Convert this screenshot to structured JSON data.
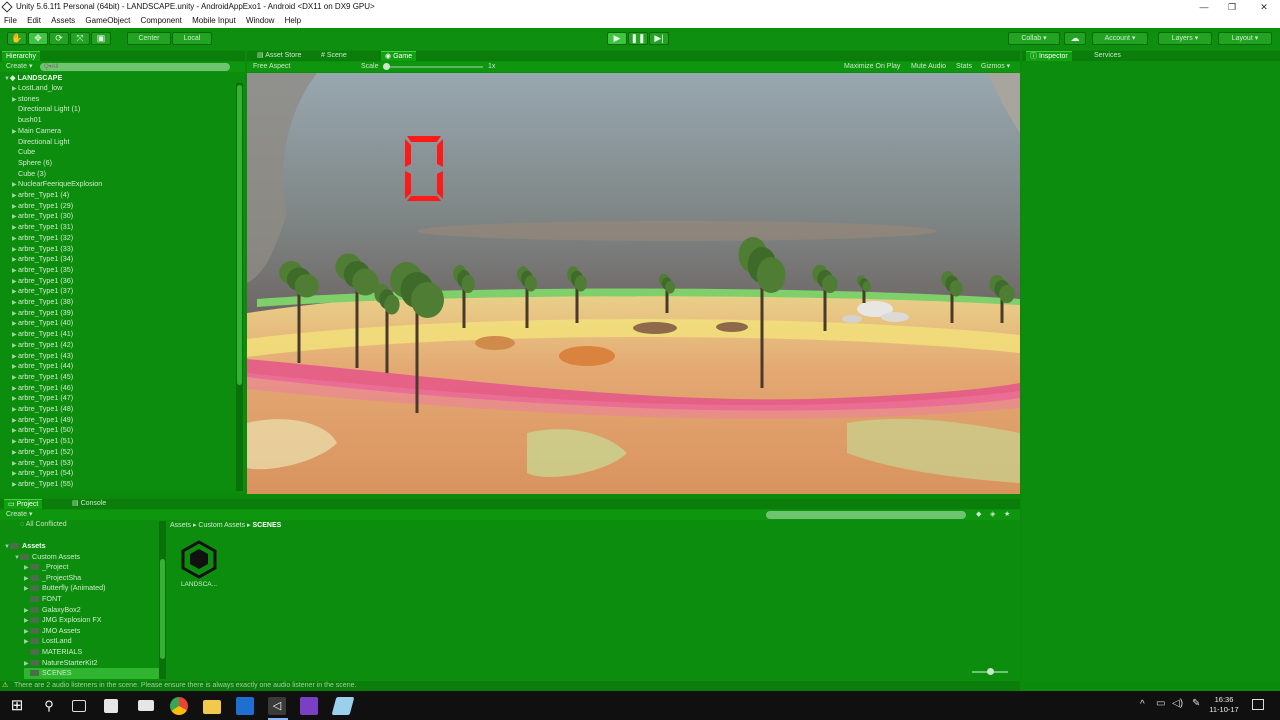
{
  "window": {
    "title": "Unity 5.6.1f1 Personal (64bit) - LANDSCAPE.unity - AndroidAppExo1 - Android <DX11 on DX9 GPU>",
    "controls": [
      "—",
      "❐",
      "✕"
    ]
  },
  "menu": [
    "File",
    "Edit",
    "Assets",
    "GameObject",
    "Component",
    "Mobile Input",
    "Window",
    "Help"
  ],
  "toolbar": {
    "pivot_mode": "Center",
    "pivot_space": "Local",
    "collab": "Collab ▾",
    "account": "Account",
    "layers": "Layers",
    "layout": "Layout"
  },
  "hierarchy": {
    "tab": "Hierarchy",
    "create": "Create ▾",
    "search_placeholder": "Q▾All",
    "scene": "LANDSCAPE",
    "items": [
      {
        "label": "LostLand_low",
        "arrow": "▶"
      },
      {
        "label": "stones",
        "arrow": "▶"
      },
      {
        "label": "Directional Light (1)",
        "arrow": ""
      },
      {
        "label": "bush01",
        "arrow": ""
      },
      {
        "label": "Main Camera",
        "arrow": "▶"
      },
      {
        "label": "Directional Light",
        "arrow": ""
      },
      {
        "label": "Cube",
        "arrow": ""
      },
      {
        "label": "Sphere (6)",
        "arrow": ""
      },
      {
        "label": "Cube (3)",
        "arrow": ""
      },
      {
        "label": "NuclearFeeriqueExplosion",
        "arrow": "▶"
      },
      {
        "label": "arbre_Type1 (4)",
        "arrow": "▶"
      },
      {
        "label": "arbre_Type1 (29)",
        "arrow": "▶"
      },
      {
        "label": "arbre_Type1 (30)",
        "arrow": "▶"
      },
      {
        "label": "arbre_Type1 (31)",
        "arrow": "▶"
      },
      {
        "label": "arbre_Type1 (32)",
        "arrow": "▶"
      },
      {
        "label": "arbre_Type1 (33)",
        "arrow": "▶"
      },
      {
        "label": "arbre_Type1 (34)",
        "arrow": "▶"
      },
      {
        "label": "arbre_Type1 (35)",
        "arrow": "▶"
      },
      {
        "label": "arbre_Type1 (36)",
        "arrow": "▶"
      },
      {
        "label": "arbre_Type1 (37)",
        "arrow": "▶"
      },
      {
        "label": "arbre_Type1 (38)",
        "arrow": "▶"
      },
      {
        "label": "arbre_Type1 (39)",
        "arrow": "▶"
      },
      {
        "label": "arbre_Type1 (40)",
        "arrow": "▶"
      },
      {
        "label": "arbre_Type1 (41)",
        "arrow": "▶"
      },
      {
        "label": "arbre_Type1 (42)",
        "arrow": "▶"
      },
      {
        "label": "arbre_Type1 (43)",
        "arrow": "▶"
      },
      {
        "label": "arbre_Type1 (44)",
        "arrow": "▶"
      },
      {
        "label": "arbre_Type1 (45)",
        "arrow": "▶"
      },
      {
        "label": "arbre_Type1 (46)",
        "arrow": "▶"
      },
      {
        "label": "arbre_Type1 (47)",
        "arrow": "▶"
      },
      {
        "label": "arbre_Type1 (48)",
        "arrow": "▶"
      },
      {
        "label": "arbre_Type1 (49)",
        "arrow": "▶"
      },
      {
        "label": "arbre_Type1 (50)",
        "arrow": "▶"
      },
      {
        "label": "arbre_Type1 (51)",
        "arrow": "▶"
      },
      {
        "label": "arbre_Type1 (52)",
        "arrow": "▶"
      },
      {
        "label": "arbre_Type1 (53)",
        "arrow": "▶"
      },
      {
        "label": "arbre_Type1 (54)",
        "arrow": "▶"
      },
      {
        "label": "arbre_Type1 (55)",
        "arrow": "▶"
      }
    ]
  },
  "center_tabs": [
    "Asset Store",
    "Scene",
    "Game"
  ],
  "game_bar": {
    "aspect": "Free Aspect",
    "scale_label": "Scale",
    "scale_value": "1x",
    "maximize": "Maximize On Play",
    "mute": "Mute Audio",
    "stats": "Stats",
    "gizmos": "Gizmos ▾"
  },
  "game_view": {
    "score": "0"
  },
  "inspector": {
    "tabs": [
      "Inspector",
      "Services"
    ]
  },
  "project": {
    "tabs": [
      "Project",
      "Console"
    ],
    "create": "Create ▾",
    "all_conflicted": "All Conflicted",
    "tree": [
      {
        "label": "Assets",
        "indent": 0,
        "arrow": "▼"
      },
      {
        "label": "Custom Assets",
        "indent": 1,
        "arrow": "▼"
      },
      {
        "label": "_Project",
        "indent": 2,
        "arrow": "▶"
      },
      {
        "label": "_ProjectSha",
        "indent": 2,
        "arrow": "▶"
      },
      {
        "label": "Butterfly (Animated)",
        "indent": 2,
        "arrow": "▶"
      },
      {
        "label": "FONT",
        "indent": 2,
        "arrow": ""
      },
      {
        "label": "GalaxyBox2",
        "indent": 2,
        "arrow": "▶"
      },
      {
        "label": "JMG Explosion FX",
        "indent": 2,
        "arrow": "▶"
      },
      {
        "label": "JMO Assets",
        "indent": 2,
        "arrow": "▶"
      },
      {
        "label": "LostLand",
        "indent": 2,
        "arrow": "▶"
      },
      {
        "label": "MATERIALS",
        "indent": 2,
        "arrow": ""
      },
      {
        "label": "NatureStarterKit2",
        "indent": 2,
        "arrow": "▶"
      },
      {
        "label": "SCENES",
        "indent": 2,
        "arrow": ""
      }
    ],
    "breadcrumb": [
      "Assets",
      "Custom Assets",
      "SCENES"
    ],
    "files": [
      {
        "label": "LANDSCA..."
      }
    ]
  },
  "status_message": "There are 2 audio listeners in the scene. Please ensure there is always exactly one audio listener in the scene.",
  "taskbar": {
    "time": "16:36",
    "date": "11-10-17"
  }
}
